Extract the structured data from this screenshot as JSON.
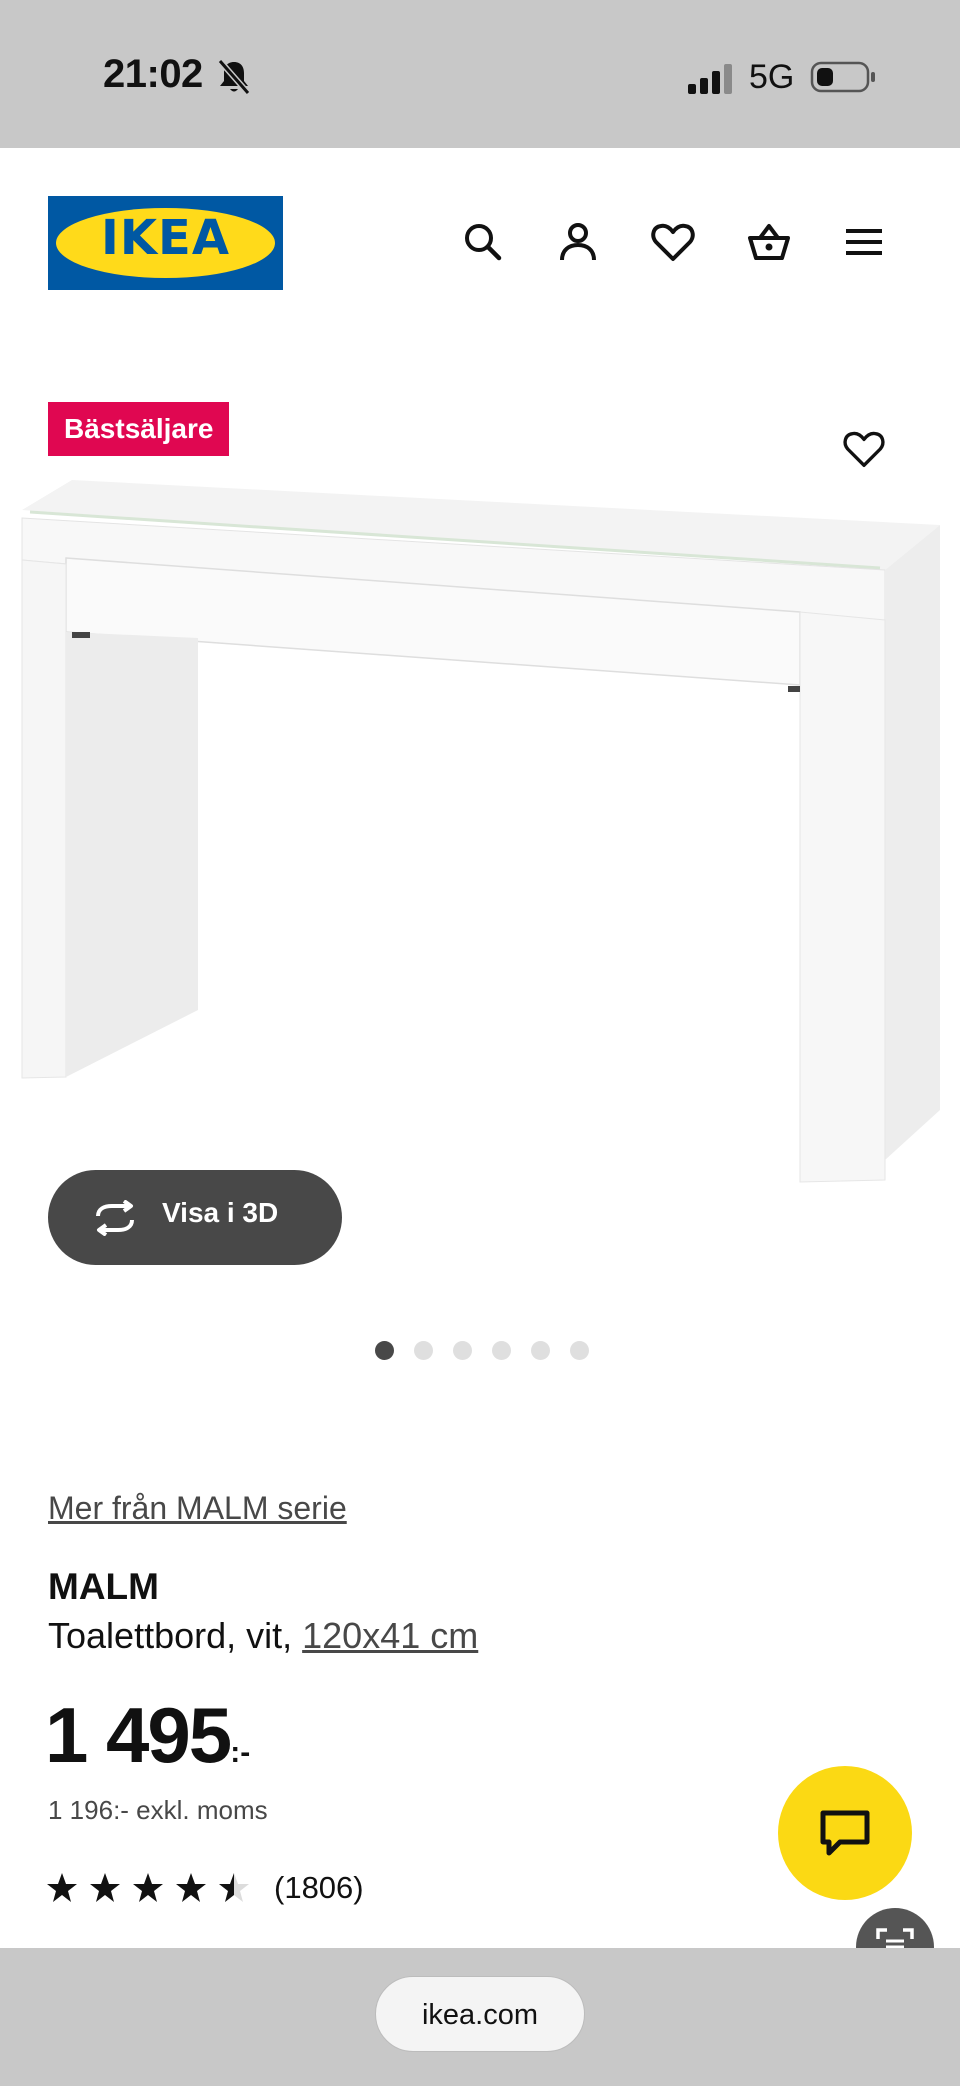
{
  "status_bar": {
    "time": "21:02",
    "network": "5G",
    "icons": [
      "bell-slash-icon",
      "signal-icon",
      "battery-icon"
    ]
  },
  "header": {
    "logo_text": "IKEA",
    "icons": [
      "search-icon",
      "account-icon",
      "heart-icon",
      "basket-icon",
      "menu-icon"
    ],
    "brand_colors": {
      "blue": "#0058a3",
      "yellow": "#ffda1a"
    }
  },
  "product": {
    "badge": "Bästsäljare",
    "badge_color": "#e00751",
    "view_3d_label": "Visa i 3D",
    "image_count": 6,
    "active_image": 1,
    "series_link": "Mer från MALM serie",
    "name": "MALM",
    "description_prefix": "Toalettbord, vit, ",
    "size": "120x41 cm",
    "price": "1 495",
    "price_suffix": ":-",
    "price_excl_vat": "1 196:- exkl. moms",
    "rating": 4.5,
    "rating_max": 5,
    "review_count": "(1806)"
  },
  "fabs": {
    "chat_color": "#fbd914",
    "icons": [
      "chat-icon",
      "scan-text-icon"
    ]
  },
  "browser": {
    "url": "ikea.com"
  }
}
